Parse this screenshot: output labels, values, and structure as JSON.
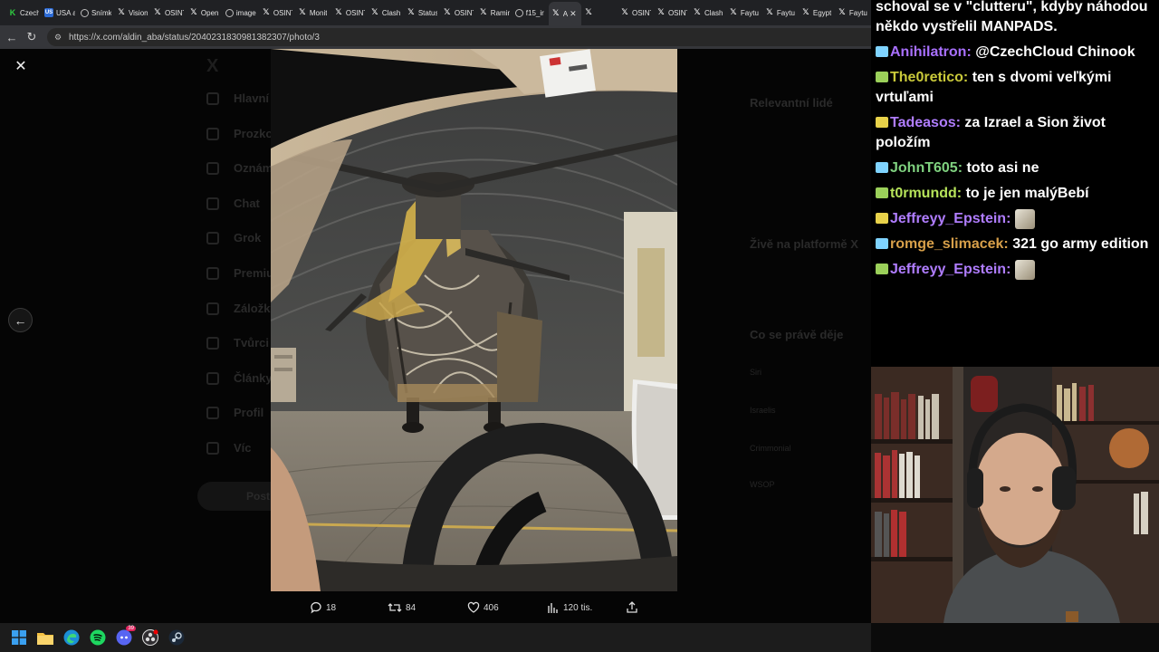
{
  "browser": {
    "tabs": [
      {
        "label": "Czech",
        "icon": "k-icon"
      },
      {
        "label": "USA a",
        "icon": "usa-icon"
      },
      {
        "label": "Snímk",
        "icon": "globe-icon"
      },
      {
        "label": "Vision",
        "icon": "x-icon"
      },
      {
        "label": "OSINT",
        "icon": "x-icon"
      },
      {
        "label": "Open",
        "icon": "x-icon"
      },
      {
        "label": "image",
        "icon": "globe-icon"
      },
      {
        "label": "OSINT",
        "icon": "x-icon"
      },
      {
        "label": "Monit",
        "icon": "x-icon"
      },
      {
        "label": "OSINT",
        "icon": "x-icon"
      },
      {
        "label": "Clash",
        "icon": "x-icon"
      },
      {
        "label": "Status",
        "icon": "x-icon"
      },
      {
        "label": "OSINT",
        "icon": "x-icon"
      },
      {
        "label": "Ramin",
        "icon": "x-icon"
      },
      {
        "label": "f15_ir",
        "icon": "globe-icon"
      },
      {
        "label": "A",
        "icon": "x-icon",
        "active": true
      },
      {
        "label": "",
        "icon": "x-icon"
      },
      {
        "label": "OSINT",
        "icon": "x-icon"
      },
      {
        "label": "OSINT",
        "icon": "x-icon"
      },
      {
        "label": "Clash",
        "icon": "x-icon"
      },
      {
        "label": "Faytu",
        "icon": "x-icon"
      },
      {
        "label": "Faytu",
        "icon": "x-icon"
      },
      {
        "label": "Egypt",
        "icon": "x-icon"
      },
      {
        "label": "Faytu",
        "icon": "x-icon"
      }
    ],
    "url": "https://x.com/aldin_aba/status/2040231830981382307/photo/3"
  },
  "x_page": {
    "nav_ghost": [
      "Hlavní",
      "Prozkoumat",
      "Oznámení",
      "Chat",
      "Grok",
      "Premium",
      "Záložky",
      "Tvůrci",
      "Články",
      "Profil",
      "Víc"
    ],
    "post_button": "Post",
    "right_ghost": [
      "Relevantní lidé",
      "Živě na platformě X",
      "Co se právě děje",
      "Siri",
      "Israelis",
      "Crimmonial",
      "WSOP"
    ],
    "actions": {
      "replies": "18",
      "reposts": "84",
      "likes": "406",
      "views": "120 tis."
    }
  },
  "chat": {
    "messages": [
      {
        "user": "",
        "text": "schoval se v \"clutteru\", kdyby náhodou někdo vystřelil MANPADS.",
        "color": "#ffffff"
      },
      {
        "user": "Anihilatron",
        "text": "@CzechCloud Chinook",
        "color": "#a970ff"
      },
      {
        "user": "The0retico",
        "text": "ten s dvomi veľkými vrtuľami",
        "color": "#c9c93a"
      },
      {
        "user": "Tadeasos",
        "text": "za Izrael a Sion život položím",
        "color": "#b07dff"
      },
      {
        "user": "JohnT605",
        "text": "toto asi ne",
        "color": "#7fd17f"
      },
      {
        "user": "t0rmundd",
        "text": "to je jen malýBebí",
        "color": "#b6e35a"
      },
      {
        "user": "Jeffreyy_Epstein",
        "text": "",
        "color": "#b07dff"
      },
      {
        "user": "romge_slimacek",
        "text": "321 go army edition",
        "color": "#d8a04a"
      },
      {
        "user": "Jeffreyy_Epstein",
        "text": "",
        "color": "#b07dff"
      }
    ]
  },
  "taskbar": {
    "icons": [
      "windows-start-icon",
      "file-explorer-icon",
      "edge-icon",
      "spotify-icon",
      "discord-icon",
      "obs-icon",
      "steam-icon"
    ],
    "discord_badge": "39"
  }
}
